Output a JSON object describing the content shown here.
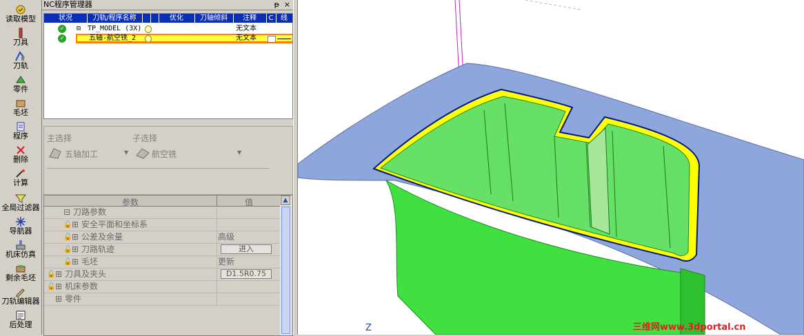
{
  "toolbar": {
    "items": [
      {
        "label": "读取模型",
        "icon": "read-model-icon"
      },
      {
        "label": "刀具",
        "icon": "tool-icon"
      },
      {
        "label": "刀轨",
        "icon": "toolpath-icon"
      },
      {
        "label": "零件",
        "icon": "part-icon"
      },
      {
        "label": "毛坯",
        "icon": "stock-icon"
      },
      {
        "label": "程序",
        "icon": "program-icon"
      },
      {
        "label": "删除",
        "icon": "delete-icon"
      },
      {
        "label": "计算",
        "icon": "calculate-icon"
      },
      {
        "label": "全局过滤器",
        "icon": "global-filter-icon"
      },
      {
        "label": "导航器",
        "icon": "navigator-icon"
      },
      {
        "label": "机床仿真",
        "icon": "machine-sim-icon"
      },
      {
        "label": "剩余毛坯",
        "icon": "remaining-stock-icon"
      },
      {
        "label": "刀轨编辑器",
        "icon": "toolpath-editor-icon"
      },
      {
        "label": "后处理",
        "icon": "postprocess-icon"
      }
    ]
  },
  "nc_manager": {
    "title": "NC程序管理器",
    "pin": "ᵽ",
    "close": "×",
    "columns": [
      "状况",
      "刀轨/程序名称",
      "优化",
      "刀轴倾斜",
      "注释",
      "C",
      "线"
    ],
    "rows": [
      {
        "expander": "⊟",
        "name": "TP_MODEL (3X)",
        "note": "无文本"
      },
      {
        "expander": "",
        "name": "五轴-航空铣_2",
        "note": "无文本"
      }
    ]
  },
  "selection": {
    "main_label": "主选择",
    "sub_label": "子选择",
    "main_value": "五轴加工",
    "sub_value": "航空铣"
  },
  "params": {
    "header_param": "参数",
    "header_value": "值",
    "rows": [
      {
        "name": "刀路参数",
        "value": "",
        "indent": 1,
        "pre": "⊟",
        "lock": false,
        "button": false
      },
      {
        "name": "安全平面和坐标系",
        "value": "",
        "indent": 2,
        "pre": "⊞",
        "lock": true,
        "button": false
      },
      {
        "name": "公差及余量",
        "value": "高级",
        "indent": 2,
        "pre": "⊞",
        "lock": true,
        "button": false
      },
      {
        "name": "刀路轨迹",
        "value": "进入",
        "indent": 2,
        "pre": "⊞",
        "lock": true,
        "button": true
      },
      {
        "name": "毛坯",
        "value": "更新",
        "indent": 2,
        "pre": "⊞",
        "lock": true,
        "button": false
      },
      {
        "name": "刀具及夹头",
        "value": "D1.5R0.75",
        "indent": 0,
        "pre": "⊞",
        "lock": true,
        "button": true
      },
      {
        "name": "机床参数",
        "value": "",
        "indent": 0,
        "pre": "⊞",
        "lock": true,
        "button": false
      },
      {
        "name": "零件",
        "value": "",
        "indent": 0,
        "pre": "⊞",
        "lock": false,
        "button": false
      }
    ]
  },
  "viewport": {
    "axis_label": "Z",
    "watermark": "三维网www.3dportal.cn"
  },
  "colors": {
    "header_blue": "#0a2fb5",
    "highlight_orange": "#ff8000",
    "part_surface": "#8fa6dc",
    "pocket_green": "#3fe03f",
    "pocket_yellow": "#ffff00",
    "tool_magenta": "#c020c0"
  }
}
